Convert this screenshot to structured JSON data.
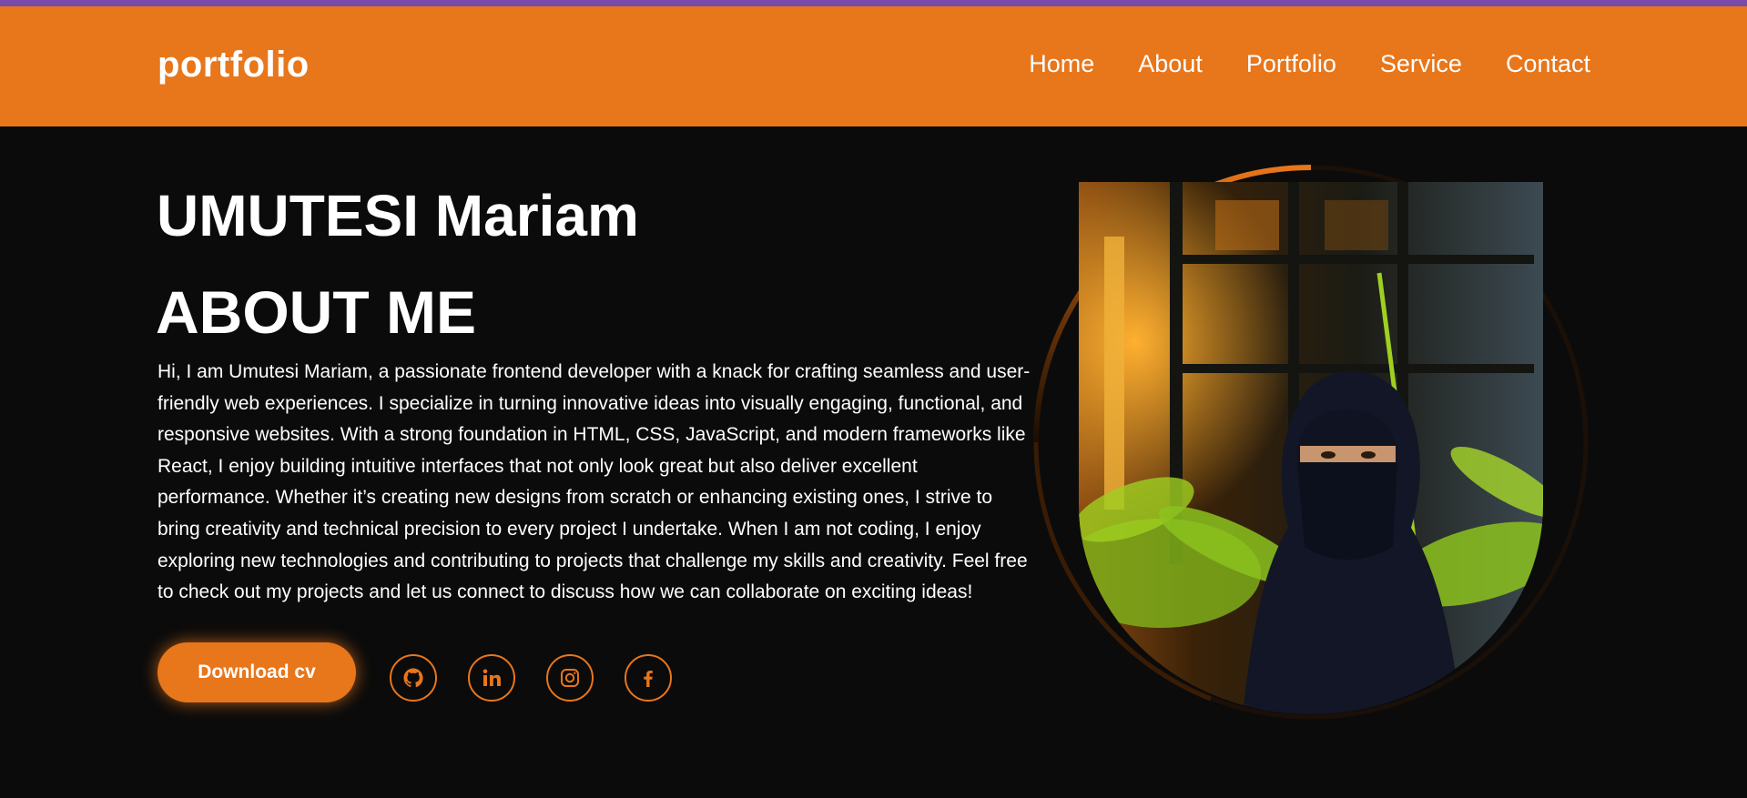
{
  "header": {
    "logo": "portfolio",
    "nav": [
      "Home",
      "About",
      "Portfolio",
      "Service",
      "Contact"
    ]
  },
  "hero": {
    "name": "UMUTESI Mariam",
    "about_title": "ABOUT ME",
    "bio": "Hi, I am Umutesi Mariam, a passionate frontend developer with a knack for crafting seamless and user-friendly web experiences. I specialize in turning innovative ideas into visually engaging, functional, and responsive websites. With a strong foundation in HTML, CSS, JavaScript, and modern frameworks like React, I enjoy building intuitive interfaces that not only look great but also deliver excellent performance. Whether it’s creating new designs from scratch or enhancing existing ones, I strive to bring creativity and technical precision to every project I undertake. When I am not coding, I enjoy exploring new technologies and contributing to projects that challenge my skills and creativity. Feel free to check out my projects and let us connect to discuss how we can collaborate on exciting ideas!",
    "cv_button": "Download cv"
  },
  "social_icons": [
    "github-icon",
    "linkedin-icon",
    "instagram-icon",
    "facebook-icon"
  ],
  "colors": {
    "accent": "#e8761b",
    "top_stripe": "#7a4aa8",
    "background": "#0b0b0b",
    "text": "#ffffff"
  }
}
